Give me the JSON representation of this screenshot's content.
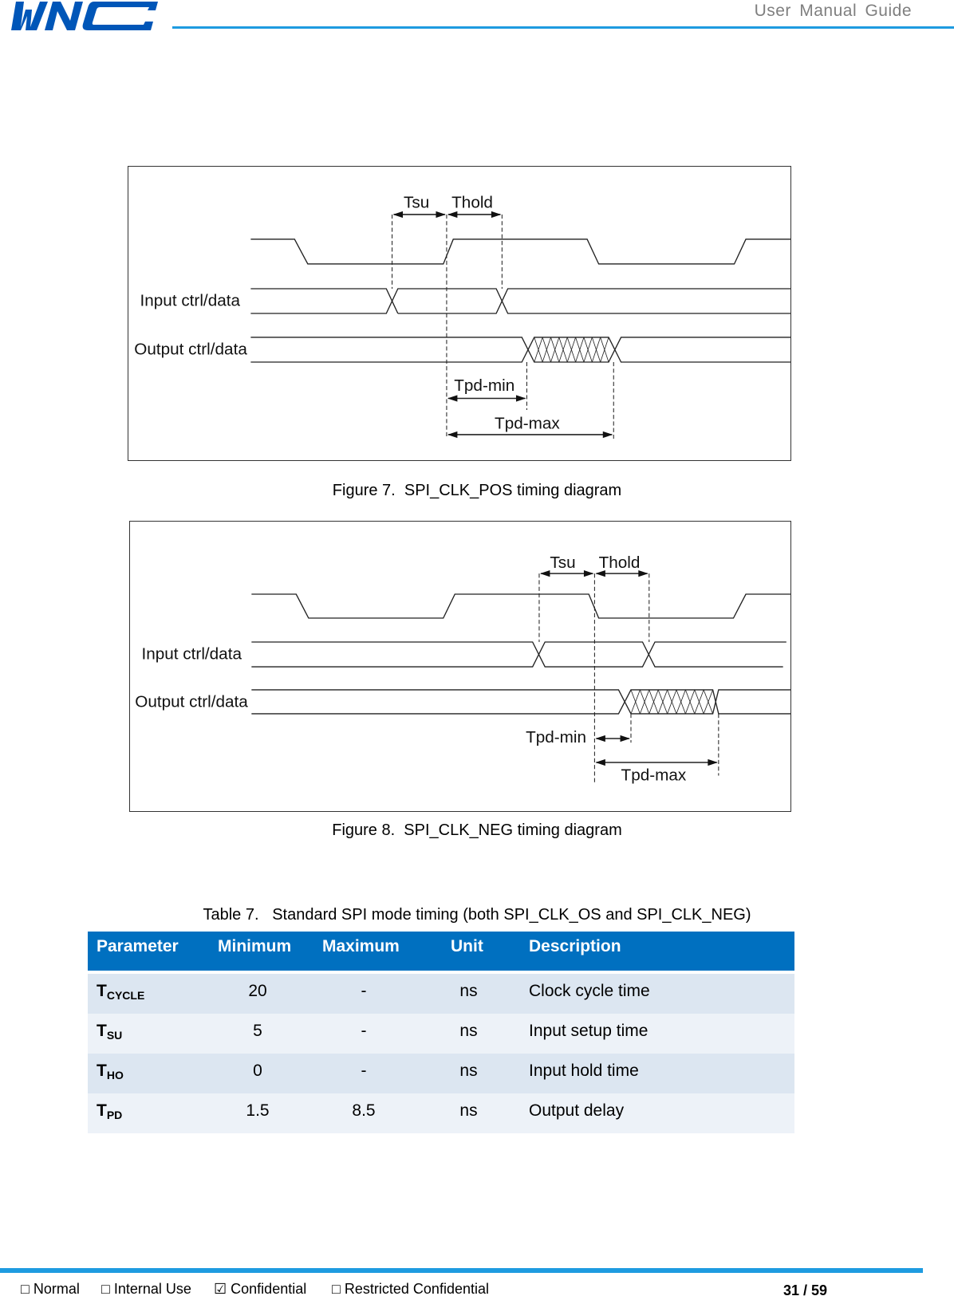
{
  "header": {
    "logo_text": "WNC",
    "title": "User Manual Guide",
    "brand_color": "#0056b8",
    "line_color": "#1e9be0"
  },
  "figure7": {
    "caption_num": "Figure 7.",
    "caption_text": "SPI_CLK_POS timing diagram",
    "labels": {
      "tsu": "Tsu",
      "thold": "Thold",
      "input": "Input ctrl/data",
      "output": "Output ctrl/data",
      "tpd_min": "Tpd-min",
      "tpd_max": "Tpd-max"
    }
  },
  "figure8": {
    "caption_num": "Figure 8.",
    "caption_text": "SPI_CLK_NEG timing diagram",
    "labels": {
      "tsu": "Tsu",
      "thold": "Thold",
      "input": "Input ctrl/data",
      "output": "Output ctrl/data",
      "tpd_min": "Tpd-min",
      "tpd_max": "Tpd-max"
    }
  },
  "table": {
    "caption_num": "Table 7.",
    "caption_text": "Standard SPI mode timing (both SPI_CLK_OS and SPI_CLK_NEG)",
    "header_color": "#0070c0",
    "columns": [
      "Parameter",
      "Minimum",
      "Maximum",
      "Unit",
      "Description"
    ],
    "rows": [
      {
        "param": "T",
        "param_sub": "CYCLE",
        "min": "20",
        "max": "-",
        "unit": "ns",
        "desc": "Clock cycle time"
      },
      {
        "param": "T",
        "param_sub": "SU",
        "min": "5",
        "max": "-",
        "unit": "ns",
        "desc": "Input setup time"
      },
      {
        "param": "T",
        "param_sub": "HO",
        "min": "0",
        "max": "-",
        "unit": "ns",
        "desc": "Input hold time"
      },
      {
        "param": "T",
        "param_sub": "PD",
        "min": "1.5",
        "max": "8.5",
        "unit": "ns",
        "desc": "Output delay"
      }
    ]
  },
  "footer": {
    "classifications": [
      {
        "mark": "□",
        "label": "Normal"
      },
      {
        "mark": "□",
        "label": "Internal Use"
      },
      {
        "mark": "☑",
        "label": "Confidential"
      },
      {
        "mark": "□",
        "label": "Restricted Confidential"
      }
    ],
    "page": "31 / 59"
  }
}
